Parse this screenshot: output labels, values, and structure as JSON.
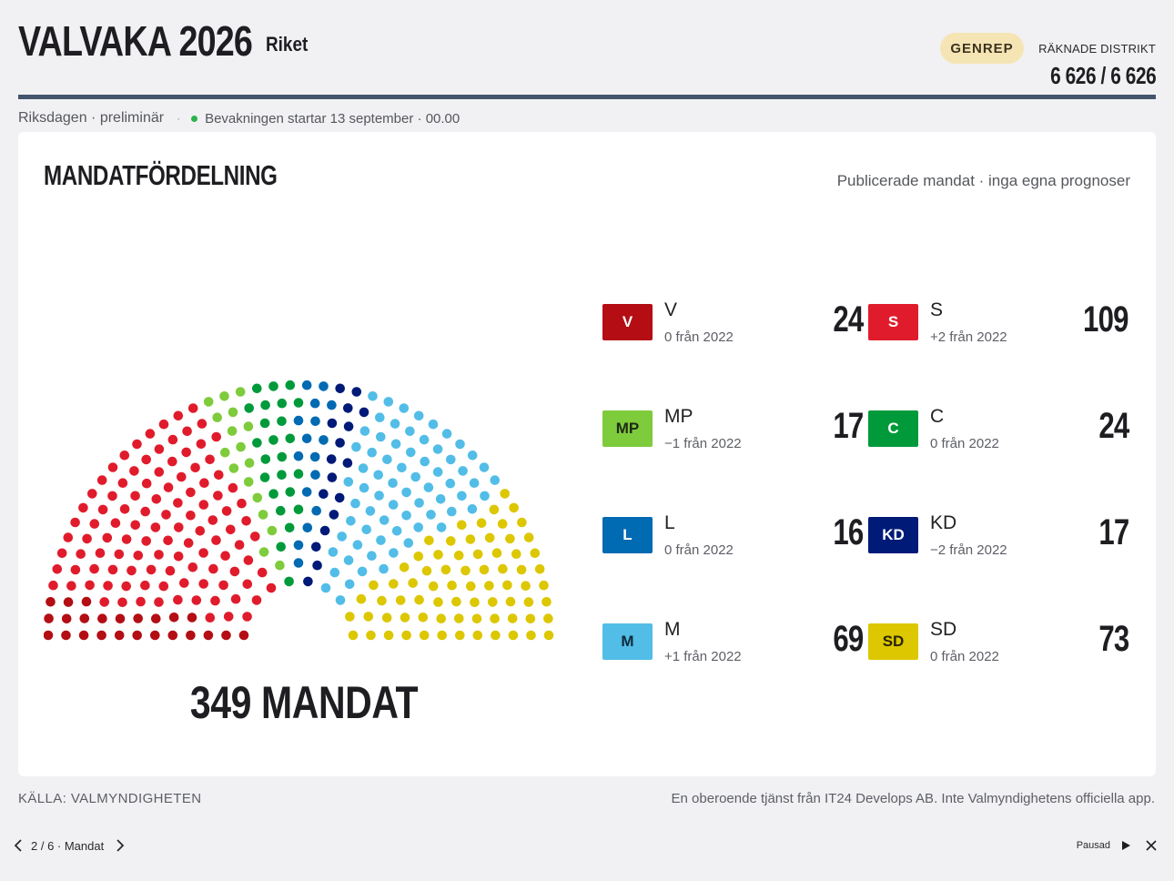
{
  "header": {
    "title": "VALVAKA 2026",
    "region": "Riket",
    "badge": "GENREP",
    "districts_label": "RÄKNADE DISTRIKT",
    "districts_value": "6 626 / 6 626",
    "rule_color": "#44546c"
  },
  "status": {
    "chamber": "Riksdagen · preliminär",
    "separator": "·",
    "live_text": "Bevakningen startar 13 september · 00.00",
    "live_color": "#29b34b"
  },
  "card": {
    "title": "MANDATFÖRDELNING",
    "note": "Publicerade mandat · inga egna prognoser",
    "total_label": "349 MANDAT"
  },
  "chart_data": {
    "type": "parliament",
    "total": 349,
    "series": [
      {
        "name": "V",
        "values": [
          24
        ],
        "color": "#b40d14"
      },
      {
        "name": "S",
        "values": [
          109
        ],
        "color": "#e01c2c"
      },
      {
        "name": "MP",
        "values": [
          17
        ],
        "color": "#7ecb3c"
      },
      {
        "name": "C",
        "values": [
          24
        ],
        "color": "#009a3b"
      },
      {
        "name": "L",
        "values": [
          16
        ],
        "color": "#006ab3"
      },
      {
        "name": "KD",
        "values": [
          17
        ],
        "color": "#001a78"
      },
      {
        "name": "M",
        "values": [
          69
        ],
        "color": "#52bde7"
      },
      {
        "name": "SD",
        "values": [
          73
        ],
        "color": "#dcc700"
      }
    ]
  },
  "parties": [
    {
      "abbr": "V",
      "name": "V",
      "change": "0 från 2022",
      "seats": "24",
      "color": "#b40d14",
      "text_color": "#ffffff"
    },
    {
      "abbr": "S",
      "name": "S",
      "change": "+2 från 2022",
      "seats": "109",
      "color": "#e01c2c",
      "text_color": "#ffffff"
    },
    {
      "abbr": "MP",
      "name": "MP",
      "change": "−1 från 2022",
      "seats": "17",
      "color": "#7ecb3c",
      "text_color": "#1e2a14"
    },
    {
      "abbr": "C",
      "name": "C",
      "change": "0 från 2022",
      "seats": "24",
      "color": "#009a3b",
      "text_color": "#ffffff"
    },
    {
      "abbr": "L",
      "name": "L",
      "change": "0 från 2022",
      "seats": "16",
      "color": "#006ab3",
      "text_color": "#ffffff"
    },
    {
      "abbr": "KD",
      "name": "KD",
      "change": "−2 från 2022",
      "seats": "17",
      "color": "#001a78",
      "text_color": "#ffffff"
    },
    {
      "abbr": "M",
      "name": "M",
      "change": "+1 från 2022",
      "seats": "69",
      "color": "#52bde7",
      "text_color": "#0d2a3a"
    },
    {
      "abbr": "SD",
      "name": "SD",
      "change": "0 från 2022",
      "seats": "73",
      "color": "#dcc700",
      "text_color": "#2a2400"
    }
  ],
  "footer": {
    "source": "KÄLLA: VALMYNDIGHETEN",
    "disclaimer": "En oberoende tjänst från IT24 Develops AB. Inte Valmyndighetens officiella app.",
    "pager": "2 / 6 · Mandat",
    "playback_status": "Pausad"
  },
  "icons": {
    "prev": "chevron-left-icon",
    "next": "chevron-right-icon",
    "play": "play-icon",
    "close": "close-icon"
  }
}
